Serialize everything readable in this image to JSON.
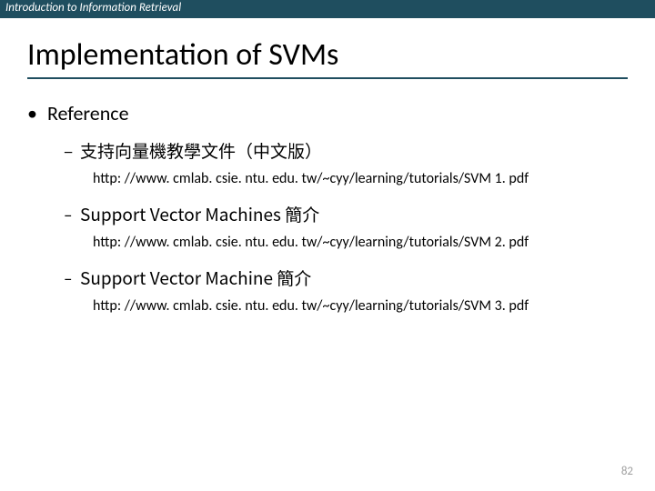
{
  "header": "Introduction to Information Retrieval",
  "title": "Implementation of SVMs",
  "reference_label": "Reference",
  "items": [
    {
      "label": "支持向量機教學文件（中文版）",
      "url": "http: //www. cmlab. csie. ntu. edu. tw/~cyy/learning/tutorials/SVM 1. pdf"
    },
    {
      "label": "Support Vector Machines  簡介",
      "url": "http: //www. cmlab. csie. ntu. edu. tw/~cyy/learning/tutorials/SVM 2. pdf"
    },
    {
      "label": "Support Vector Machine 簡介",
      "url": "http: //www. cmlab. csie. ntu. edu. tw/~cyy/learning/tutorials/SVM 3. pdf"
    }
  ],
  "page_number": "82"
}
